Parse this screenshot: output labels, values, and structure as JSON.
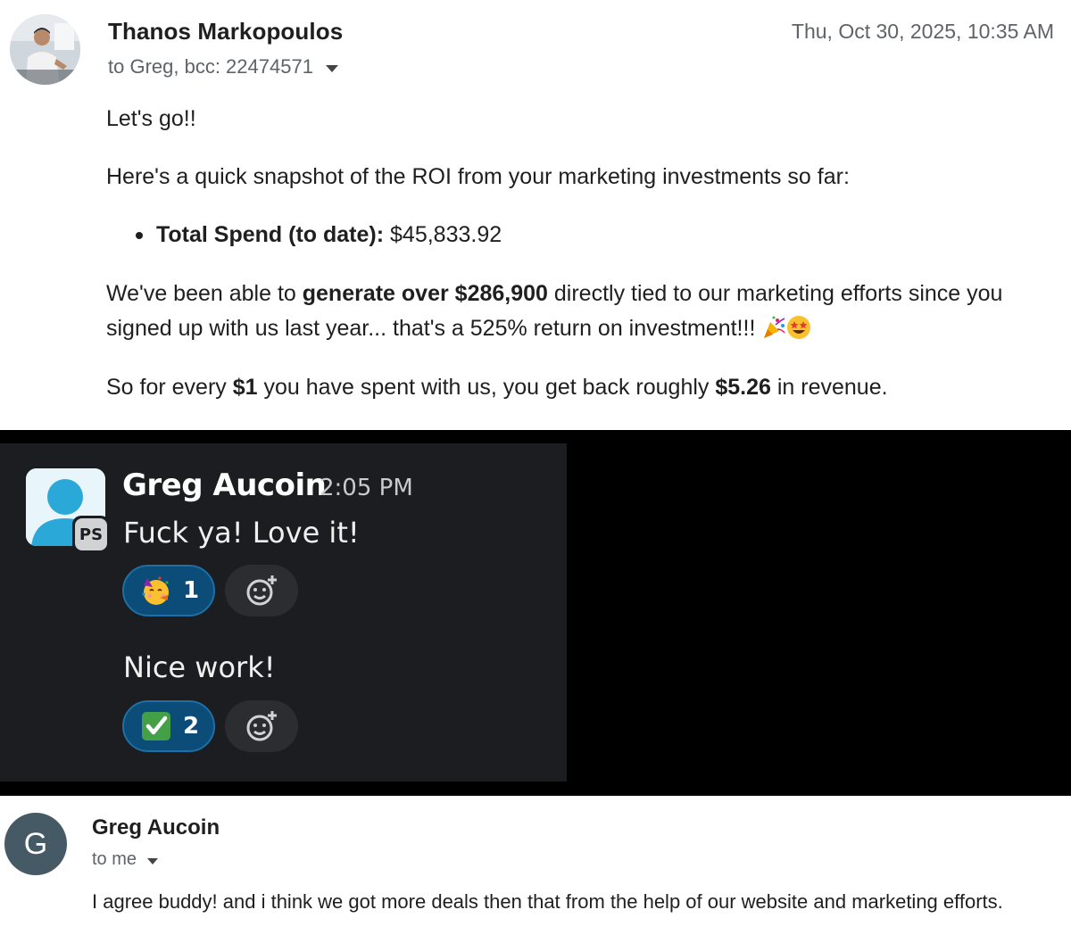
{
  "email1": {
    "sender": "Thanos Markopoulos",
    "date": "Thu, Oct 30, 2025, 10:35 AM",
    "recipients": "to Greg, bcc: 22474571",
    "greeting": "Let's go!!",
    "intro": "Here's a quick snapshot of the ROI from your marketing investments so far:",
    "bullet_label": "Total Spend (to date):",
    "bullet_value": " $45,833.92",
    "gen_prefix": "We've been able to ",
    "gen_bold": "generate over $286,900",
    "gen_suffix": " directly tied to our marketing efforts since you signed up with us last year... that's a 525% return on investment!!! ",
    "every_prefix": "So for every ",
    "every_bold1": "$1",
    "every_mid": " you have spent with us, you get back roughly ",
    "every_bold2": "$5.26",
    "every_suffix": " in revenue."
  },
  "slack": {
    "name": "Greg Aucoin",
    "time": "2:05 PM",
    "badge": "PS",
    "message1": "Fuck ya! Love it!",
    "reaction1_count": "1",
    "message2": "Nice work!",
    "reaction2_count": "2"
  },
  "email2": {
    "avatar_letter": "G",
    "sender": "Greg Aucoin",
    "recipients": "to me",
    "body": "I agree buddy! and i think we got more deals then that from the help of our website and marketing efforts."
  },
  "icons": {
    "party-popper": "party-popper-icon",
    "star-struck": "star-struck-icon",
    "partying-face": "partying-face-icon",
    "check-mark": "check-mark-icon",
    "add-reaction": "add-reaction-icon"
  },
  "colors": {
    "slack_bg": "#1b1d21",
    "reaction_bg": "#0b4c79",
    "gmail_avatar": "#455a64"
  }
}
